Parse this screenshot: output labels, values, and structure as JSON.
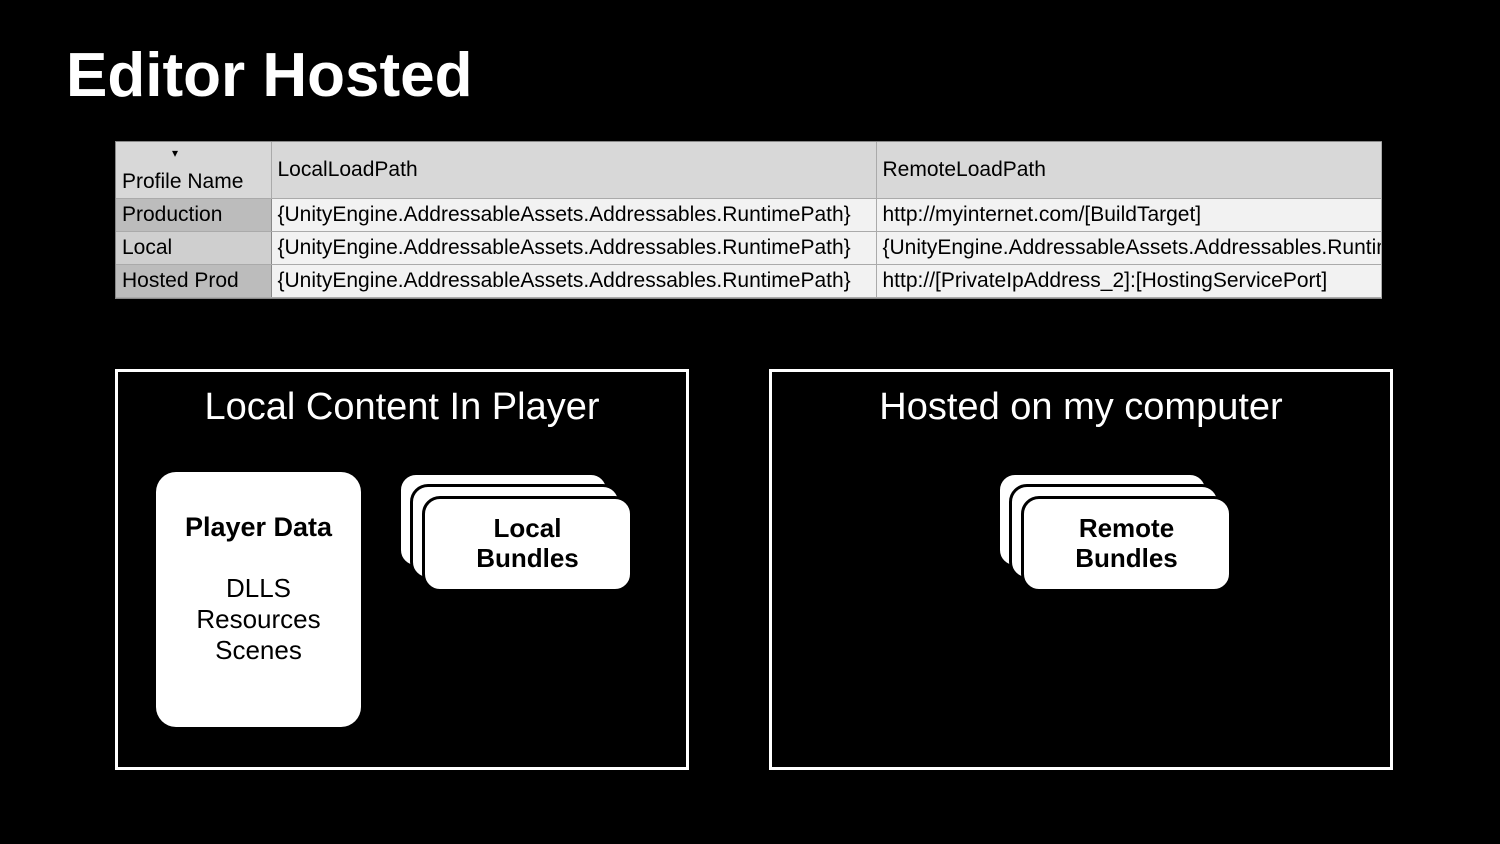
{
  "title": "Editor Hosted",
  "table": {
    "headers": [
      "Profile Name",
      "LocalLoadPath",
      "RemoteLoadPath"
    ],
    "rows": [
      {
        "name": "Production",
        "local": "{UnityEngine.AddressableAssets.Addressables.RuntimePath}",
        "remote": "http://myinternet.com/[BuildTarget]"
      },
      {
        "name": "Local",
        "local": "{UnityEngine.AddressableAssets.Addressables.RuntimePath}",
        "remote": "{UnityEngine.AddressableAssets.Addressables.RuntimePath}"
      },
      {
        "name": "Hosted Prod",
        "local": "{UnityEngine.AddressableAssets.Addressables.RuntimePath}",
        "remote": "http://[PrivateIpAddress_2]:[HostingServicePort]"
      }
    ]
  },
  "panels": {
    "left": {
      "title": "Local Content In Player",
      "player_card": {
        "title": "Player Data",
        "lines": [
          "DLLS",
          "Resources",
          "Scenes"
        ]
      },
      "bundle_label": "Local\nBundles"
    },
    "right": {
      "title": "Hosted on my computer",
      "bundle_label": "Remote\nBundles"
    }
  }
}
